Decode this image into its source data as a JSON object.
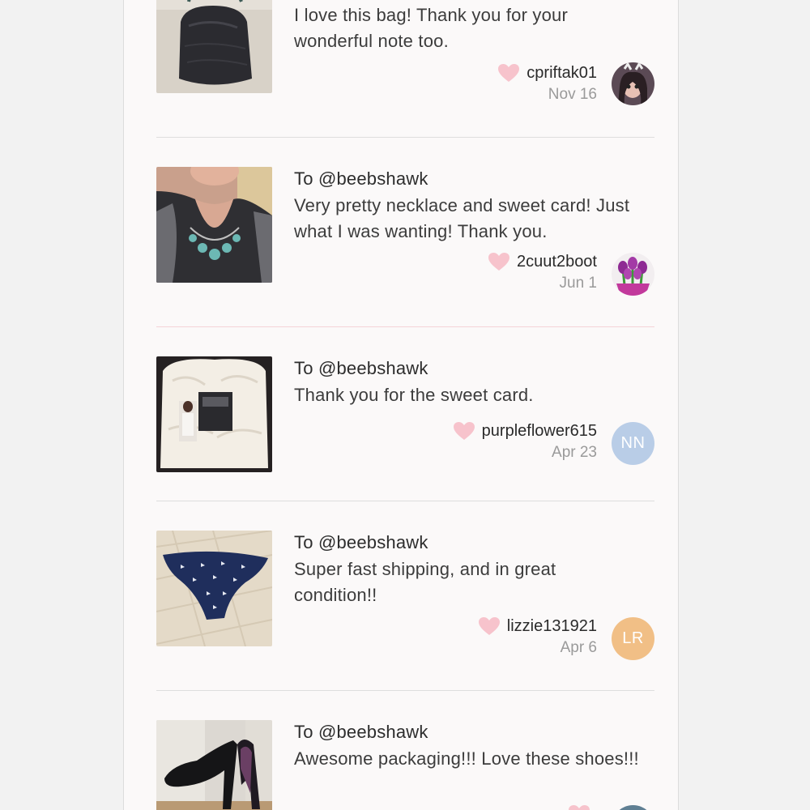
{
  "colors": {
    "page_bg": "#fbf9f9",
    "heart": "#f7c3cc",
    "avatar_nn": "#b9cde7",
    "avatar_lr": "#f1bf86",
    "avatar_partial": "#5f7f93"
  },
  "notes": [
    {
      "to": "",
      "message": "I love this bag! Thank you for your wonderful note too.",
      "username": "cpriftak01",
      "date": "Nov 16",
      "avatar": {
        "type": "photo",
        "initials": ""
      },
      "image_icon": "handbag-photo"
    },
    {
      "to": "To @beebshawk",
      "message": "Very pretty necklace and sweet card! Just what I was wanting! Thank you.",
      "username": "2cuut2boot",
      "date": "Jun 1",
      "avatar": {
        "type": "photo",
        "initials": ""
      },
      "image_icon": "necklace-photo"
    },
    {
      "to": "To @beebshawk",
      "message": "Thank you for the sweet card.",
      "username": "purpleflower615",
      "date": "Apr 23",
      "avatar": {
        "type": "initials",
        "initials": "NN"
      },
      "image_icon": "robe-photo"
    },
    {
      "to": "To @beebshawk",
      "message": "Super fast shipping, and in great condition!!",
      "username": "lizzie131921",
      "date": "Apr 6",
      "avatar": {
        "type": "initials",
        "initials": "LR"
      },
      "image_icon": "swim-bottom-photo"
    },
    {
      "to": "To @beebshawk",
      "message": "Awesome packaging!!! Love these shoes!!!",
      "username": "",
      "date": "",
      "avatar": {
        "type": "partial",
        "initials": ""
      },
      "image_icon": "shoes-photo"
    }
  ]
}
